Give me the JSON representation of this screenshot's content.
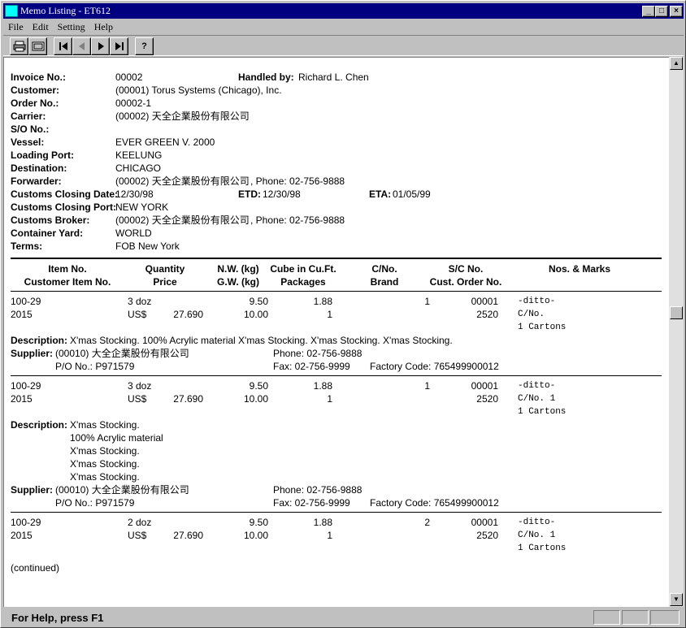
{
  "window": {
    "title": "Memo Listing - ET612"
  },
  "menu": {
    "file": "File",
    "edit": "Edit",
    "setting": "Setting",
    "help": "Help"
  },
  "toolbar": {
    "icons": [
      "printer-icon",
      "print-preview-icon",
      "first-record-icon",
      "previous-record-icon",
      "next-record-icon",
      "last-record-icon",
      "help-icon"
    ],
    "help_glyph": "?"
  },
  "header": {
    "invoice_no": {
      "label": "Invoice No.:",
      "value": "00002"
    },
    "handled_by": {
      "label": "Handled by:",
      "value": "Richard L. Chen"
    },
    "customer": {
      "label": "Customer:",
      "value": "(00001) Torus Systems (Chicago), Inc."
    },
    "order_no": {
      "label": "Order No.:",
      "value": "00002-1"
    },
    "carrier": {
      "label": "Carrier:",
      "value": "(00002) 天全企業股份有限公司"
    },
    "so_no": {
      "label": "S/O No.:",
      "value": ""
    },
    "vessel": {
      "label": "Vessel:",
      "value": "EVER GREEN V. 2000"
    },
    "loading_port": {
      "label": "Loading Port:",
      "value": "KEELUNG"
    },
    "destination": {
      "label": "Destination:",
      "value": "CHICAGO"
    },
    "forwarder": {
      "label": "Forwarder:",
      "value": "(00002) 天全企業股份有限公司",
      "phone": ", Phone: 02-756-9888"
    },
    "customs_closing_date": {
      "label": "Customs Closing Date:",
      "value": "12/30/98"
    },
    "etd": {
      "label": "ETD:",
      "value": "12/30/98"
    },
    "eta": {
      "label": "ETA:",
      "value": "01/05/99"
    },
    "customs_closing_port": {
      "label": "Customs Closing Port:",
      "value": "NEW YORK"
    },
    "customs_broker": {
      "label": "Customs Broker:",
      "value": "(00002) 天全企業股份有限公司",
      "phone": ", Phone: 02-756-9888"
    },
    "container_yard": {
      "label": "Container Yard:",
      "value": "WORLD"
    },
    "terms": {
      "label": "Terms:",
      "value": "FOB New York"
    }
  },
  "columns": {
    "item_no": "Item No.",
    "customer_item_no": "Customer Item No.",
    "quantity": "Quantity",
    "price": "Price",
    "nw": "N.W. (kg)",
    "gw": "G.W. (kg)",
    "cube": "Cube in Cu.Ft.",
    "packages": "Packages",
    "cno": "C/No.",
    "brand": "Brand",
    "sc_no": "S/C No.",
    "cust_order_no": "Cust. Order No.",
    "nos_marks": "Nos. & Marks"
  },
  "items": [
    {
      "item_no": "100-29",
      "customer_item_no": "2015",
      "quantity": "3 doz",
      "currency": "US$",
      "price": "27.690",
      "nw": "9.50",
      "gw": "10.00",
      "cube": "1.88",
      "packages": "1",
      "cno": "1",
      "sc_no": "00001",
      "cust_order_no": "2520",
      "marks": [
        "-ditto-",
        "C/No.",
        "1 Cartons"
      ],
      "description_label": "Description:",
      "description": [
        "X'mas Stocking. 100% Acrylic material X'mas Stocking. X'mas Stocking. X'mas Stocking."
      ],
      "supplier_label": "Supplier:",
      "supplier": "(00010) 大全企業股份有限公司",
      "phone": "Phone: 02-756-9888",
      "po_no": "P/O No.: P971579",
      "fax": "Fax: 02-756-9999",
      "factory_code": "Factory Code: 765499900012"
    },
    {
      "item_no": "100-29",
      "customer_item_no": "2015",
      "quantity": "3 doz",
      "currency": "US$",
      "price": "27.690",
      "nw": "9.50",
      "gw": "10.00",
      "cube": "1.88",
      "packages": "1",
      "cno": "1",
      "sc_no": "00001",
      "cust_order_no": "2520",
      "marks": [
        "-ditto-",
        "C/No. 1",
        "1 Cartons"
      ],
      "description_label": "Description:",
      "description": [
        "X'mas Stocking.",
        "100% Acrylic material",
        "X'mas Stocking.",
        "X'mas Stocking.",
        "X'mas Stocking."
      ],
      "supplier_label": "Supplier:",
      "supplier": "(00010) 大全企業股份有限公司",
      "phone": "Phone: 02-756-9888",
      "po_no": "P/O No.: P971579",
      "fax": "Fax: 02-756-9999",
      "factory_code": "Factory Code: 765499900012"
    },
    {
      "item_no": "100-29",
      "customer_item_no": "2015",
      "quantity": "2 doz",
      "currency": "US$",
      "price": "27.690",
      "nw": "9.50",
      "gw": "10.00",
      "cube": "1.88",
      "packages": "1",
      "cno": "2",
      "sc_no": "00001",
      "cust_order_no": "2520",
      "marks": [
        "-ditto-",
        "C/No. 1",
        "1 Cartons"
      ]
    }
  ],
  "continued": "(continued)",
  "status": {
    "text": "For Help, press F1"
  }
}
